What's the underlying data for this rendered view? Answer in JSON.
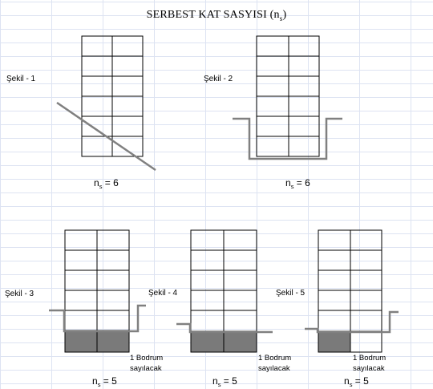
{
  "title": {
    "main": "SERBEST KAT SASYISI (n",
    "sub": "s",
    "close": ")"
  },
  "ne_symbol": {
    "base": "n",
    "sub": "s"
  },
  "figures": [
    {
      "label": "Şekil - 1",
      "ne_text": " = 6"
    },
    {
      "label": "Şekil - 2",
      "ne_text": " = 6"
    },
    {
      "label": "Şekil - 3",
      "ne_text": " = 5",
      "note_line1": "1 Bodrum",
      "note_line2": "sayılacak"
    },
    {
      "label": "Şekil - 4",
      "ne_text": " = 5",
      "note_line1": "1 Bodrum",
      "note_line2": "sayılacak"
    },
    {
      "label": "Şekil - 5",
      "ne_text": " = 5",
      "note_line1": "1 Bodrum",
      "note_line2": "sayılacak"
    }
  ],
  "colors": {
    "grid": "#dde3f2",
    "ground": "#808080",
    "basement": "#7a7a7a",
    "frame": "#000000"
  }
}
